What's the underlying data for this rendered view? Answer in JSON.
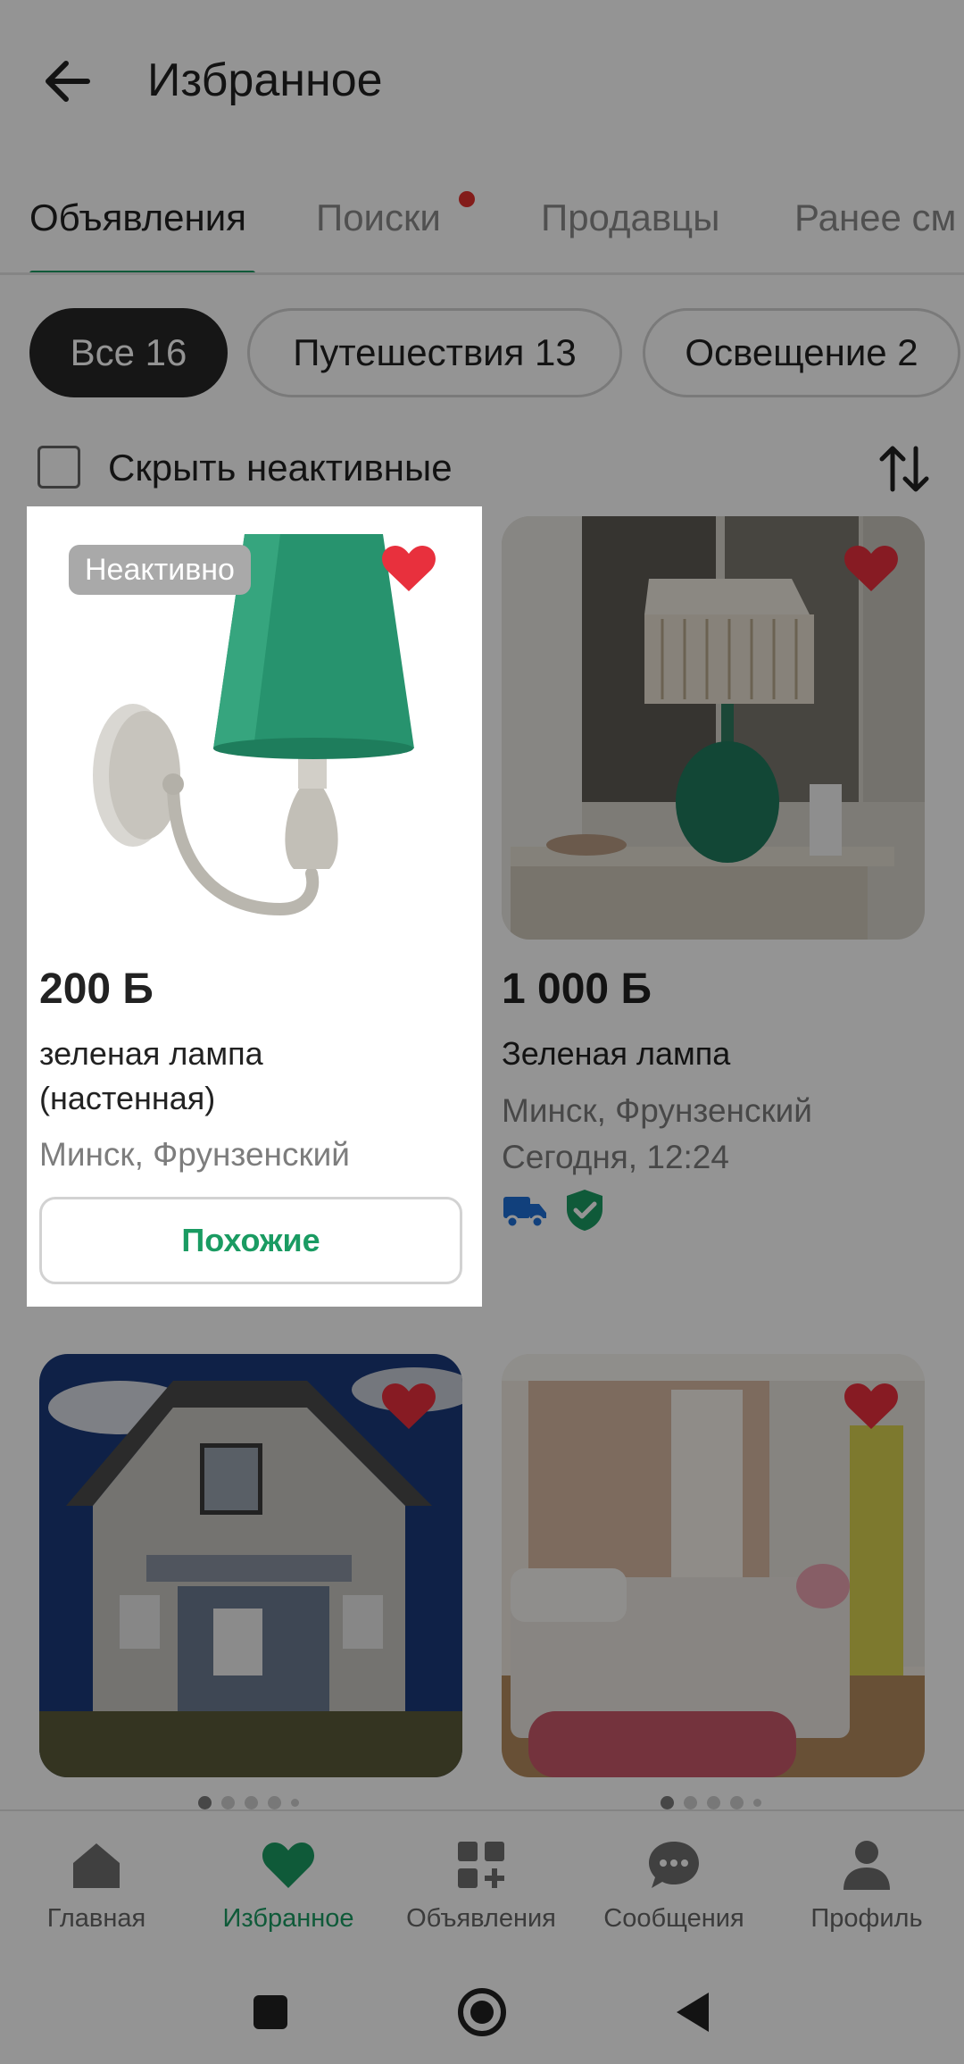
{
  "header": {
    "title": "Избранное"
  },
  "tabs": [
    {
      "label": "Объявления",
      "active": true
    },
    {
      "label": "Поиски",
      "has_notification": true
    },
    {
      "label": "Продавцы"
    },
    {
      "label": "Ранее см"
    }
  ],
  "chips": [
    {
      "label": "Все 16",
      "active": true
    },
    {
      "label": "Путешествия 13"
    },
    {
      "label": "Освещение 2"
    }
  ],
  "filter": {
    "hide_inactive_label": "Скрыть неактивные",
    "checked": false
  },
  "listings": [
    {
      "badge": "Неактивно",
      "price": "200 Б",
      "title_line1": "зеленая лампа",
      "title_line2": "(настенная)",
      "location": "Минск, Фрунзенский",
      "similar_label": "Похожие",
      "favorite": true
    },
    {
      "price": "1 000 Б",
      "title": "Зеленая лампа",
      "location": "Минск, Фрунзенский",
      "date": "Сегодня, 12:24",
      "icons": [
        "delivery-truck-icon",
        "verified-shield-icon"
      ],
      "favorite": true
    },
    {
      "favorite": true,
      "photo": "house"
    },
    {
      "favorite": true,
      "photo": "bedroom"
    }
  ],
  "bottom_nav": [
    {
      "label": "Главная",
      "icon": "home-icon"
    },
    {
      "label": "Избранное",
      "icon": "heart-icon",
      "active": true
    },
    {
      "label": "Объявления",
      "icon": "grid-plus-icon"
    },
    {
      "label": "Сообщения",
      "icon": "chat-icon"
    },
    {
      "label": "Профиль",
      "icon": "person-icon"
    }
  ],
  "colors": {
    "accent_green": "#1a9b62",
    "heart_red": "#e8303d",
    "notification_red": "#e2312d",
    "chip_active_bg": "#262626"
  }
}
